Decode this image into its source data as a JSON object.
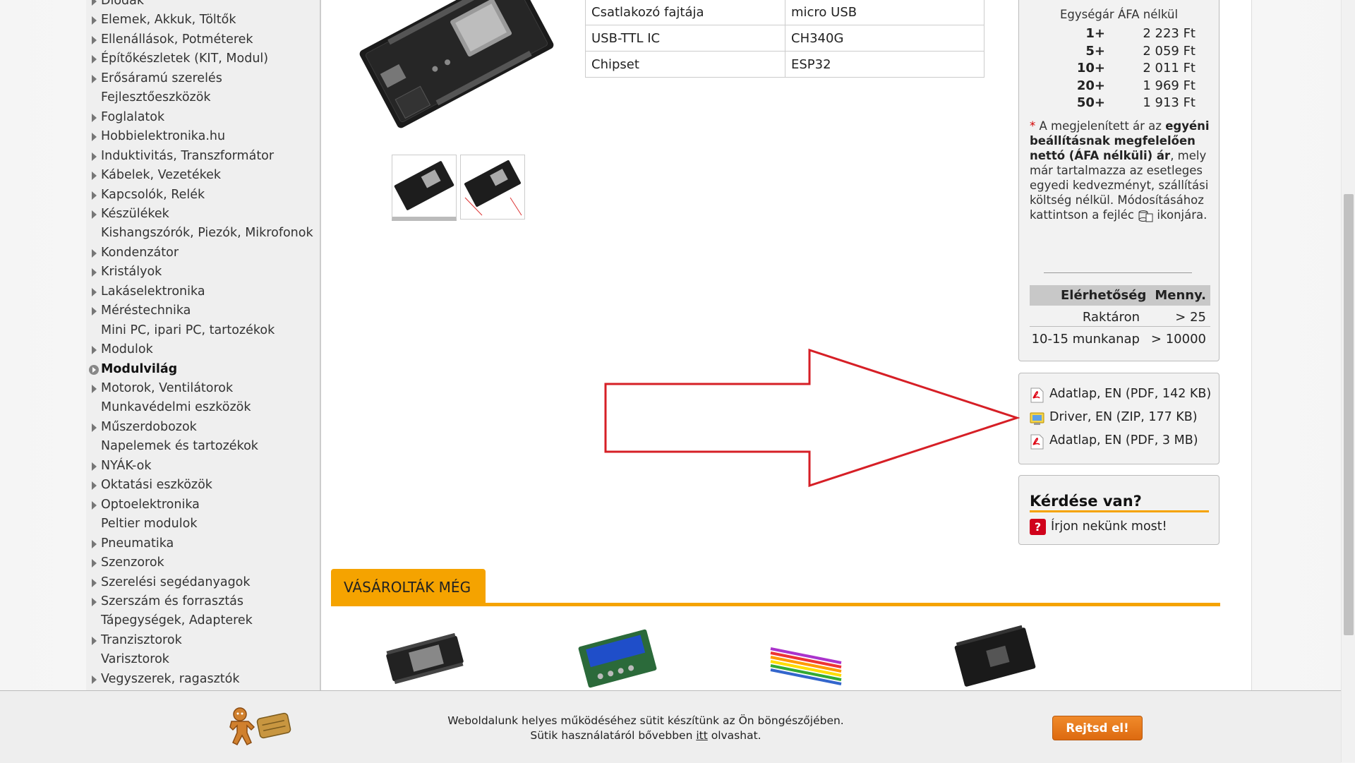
{
  "sidebar": {
    "items": [
      {
        "label": "Diódák",
        "arrow": true
      },
      {
        "label": "Elemek, Akkuk, Töltők",
        "arrow": true
      },
      {
        "label": "Ellenállások, Potméterek",
        "arrow": true
      },
      {
        "label": "Építőkészletek (KIT, Modul)",
        "arrow": true
      },
      {
        "label": "Erősáramú szerelés",
        "arrow": true
      },
      {
        "label": "Fejlesztőeszközök",
        "arrow": false
      },
      {
        "label": "Foglalatok",
        "arrow": true
      },
      {
        "label": "Hobbielektronika.hu",
        "arrow": true
      },
      {
        "label": "Induktivitás, Transzformátor",
        "arrow": true
      },
      {
        "label": "Kábelek, Vezetékek",
        "arrow": true
      },
      {
        "label": "Kapcsolók, Relék",
        "arrow": true
      },
      {
        "label": "Készülékek",
        "arrow": true
      },
      {
        "label": "Kishangszórók, Piezók, Mikrofonok",
        "arrow": false
      },
      {
        "label": "Kondenzátor",
        "arrow": true
      },
      {
        "label": "Kristályok",
        "arrow": true
      },
      {
        "label": "Lakáselektronika",
        "arrow": true
      },
      {
        "label": "Méréstechnika",
        "arrow": true
      },
      {
        "label": "Mini PC, ipari PC, tartozékok",
        "arrow": false
      },
      {
        "label": "Modulok",
        "arrow": true
      },
      {
        "label": "Modulvilág",
        "arrow": false,
        "active": true
      },
      {
        "label": "Motorok, Ventilátorok",
        "arrow": true
      },
      {
        "label": "Munkavédelmi eszközök",
        "arrow": false
      },
      {
        "label": "Műszerdobozok",
        "arrow": true
      },
      {
        "label": "Napelemek és tartozékok",
        "arrow": false
      },
      {
        "label": "NYÁK-ok",
        "arrow": true
      },
      {
        "label": "Oktatási eszközök",
        "arrow": true
      },
      {
        "label": "Optoelektronika",
        "arrow": true
      },
      {
        "label": "Peltier modulok",
        "arrow": false
      },
      {
        "label": "Pneumatika",
        "arrow": true
      },
      {
        "label": "Szenzorok",
        "arrow": true
      },
      {
        "label": "Szerelési segédanyagok",
        "arrow": true
      },
      {
        "label": "Szerszám és forrasztás",
        "arrow": true
      },
      {
        "label": "Tápegységek, Adapterek",
        "arrow": false
      },
      {
        "label": "Tranzisztorok",
        "arrow": true
      },
      {
        "label": "Varisztorok",
        "arrow": false
      },
      {
        "label": "Vegyszerek, ragasztók",
        "arrow": true
      }
    ]
  },
  "specs": [
    {
      "name": "Csatlakozó fajtája",
      "value": "micro USB"
    },
    {
      "name": "USB-TTL IC",
      "value": "CH340G"
    },
    {
      "name": "Chipset",
      "value": "ESP32"
    }
  ],
  "price": {
    "title": "Egységár ÁFA nélkül",
    "tiers": [
      {
        "qty": "1+",
        "value": "2 223 Ft"
      },
      {
        "qty": "5+",
        "value": "2 059 Ft"
      },
      {
        "qty": "10+",
        "value": "2 011 Ft"
      },
      {
        "qty": "20+",
        "value": "1 969 Ft"
      },
      {
        "qty": "50+",
        "value": "1 913 Ft"
      }
    ],
    "note_star": "*",
    "note_a": " A megjelenített ár az ",
    "note_bold": "egyéni beállításnak megfelelően nettó (ÁFA nélküli) ár",
    "note_b": ", mely már tartalmazza az esetleges egyedi kedvezményt, szállítási költség nélkül. Módosításához kattintson a fejléc ",
    "note_c": " ikonjára."
  },
  "availability": {
    "head_status": "Elérhetőség",
    "head_qty": "Menny.",
    "rows": [
      {
        "status": "Raktáron",
        "qty": "> 25"
      },
      {
        "status": "10-15 munkanap",
        "qty": "> 10000"
      }
    ]
  },
  "downloads": [
    {
      "label": "Adatlap, EN (PDF, 142 KB)",
      "icon": "pdf-icon"
    },
    {
      "label": "Driver, EN (ZIP, 177 KB)",
      "icon": "zip-icon"
    },
    {
      "label": "Adatlap, EN (PDF, 3 MB)",
      "icon": "pdf-icon"
    }
  ],
  "question": {
    "title": "Kérdése van?",
    "link": "Írjon nekünk most!",
    "icon_char": "?"
  },
  "also_bought": {
    "tab_label": "VÁSÁROLTÁK MÉG"
  },
  "cookie": {
    "line1": "Weboldalunk helyes működéséhez sütit készítünk az Ön böngészőjében.",
    "line2a": "Sütik használatáról bővebben ",
    "line2link": "itt",
    "line2b": " olvashat.",
    "button": "Rejtsd el!"
  },
  "colors": {
    "accent": "#f5a300",
    "arrow": "#d61f26",
    "button": "#e77a1d"
  }
}
